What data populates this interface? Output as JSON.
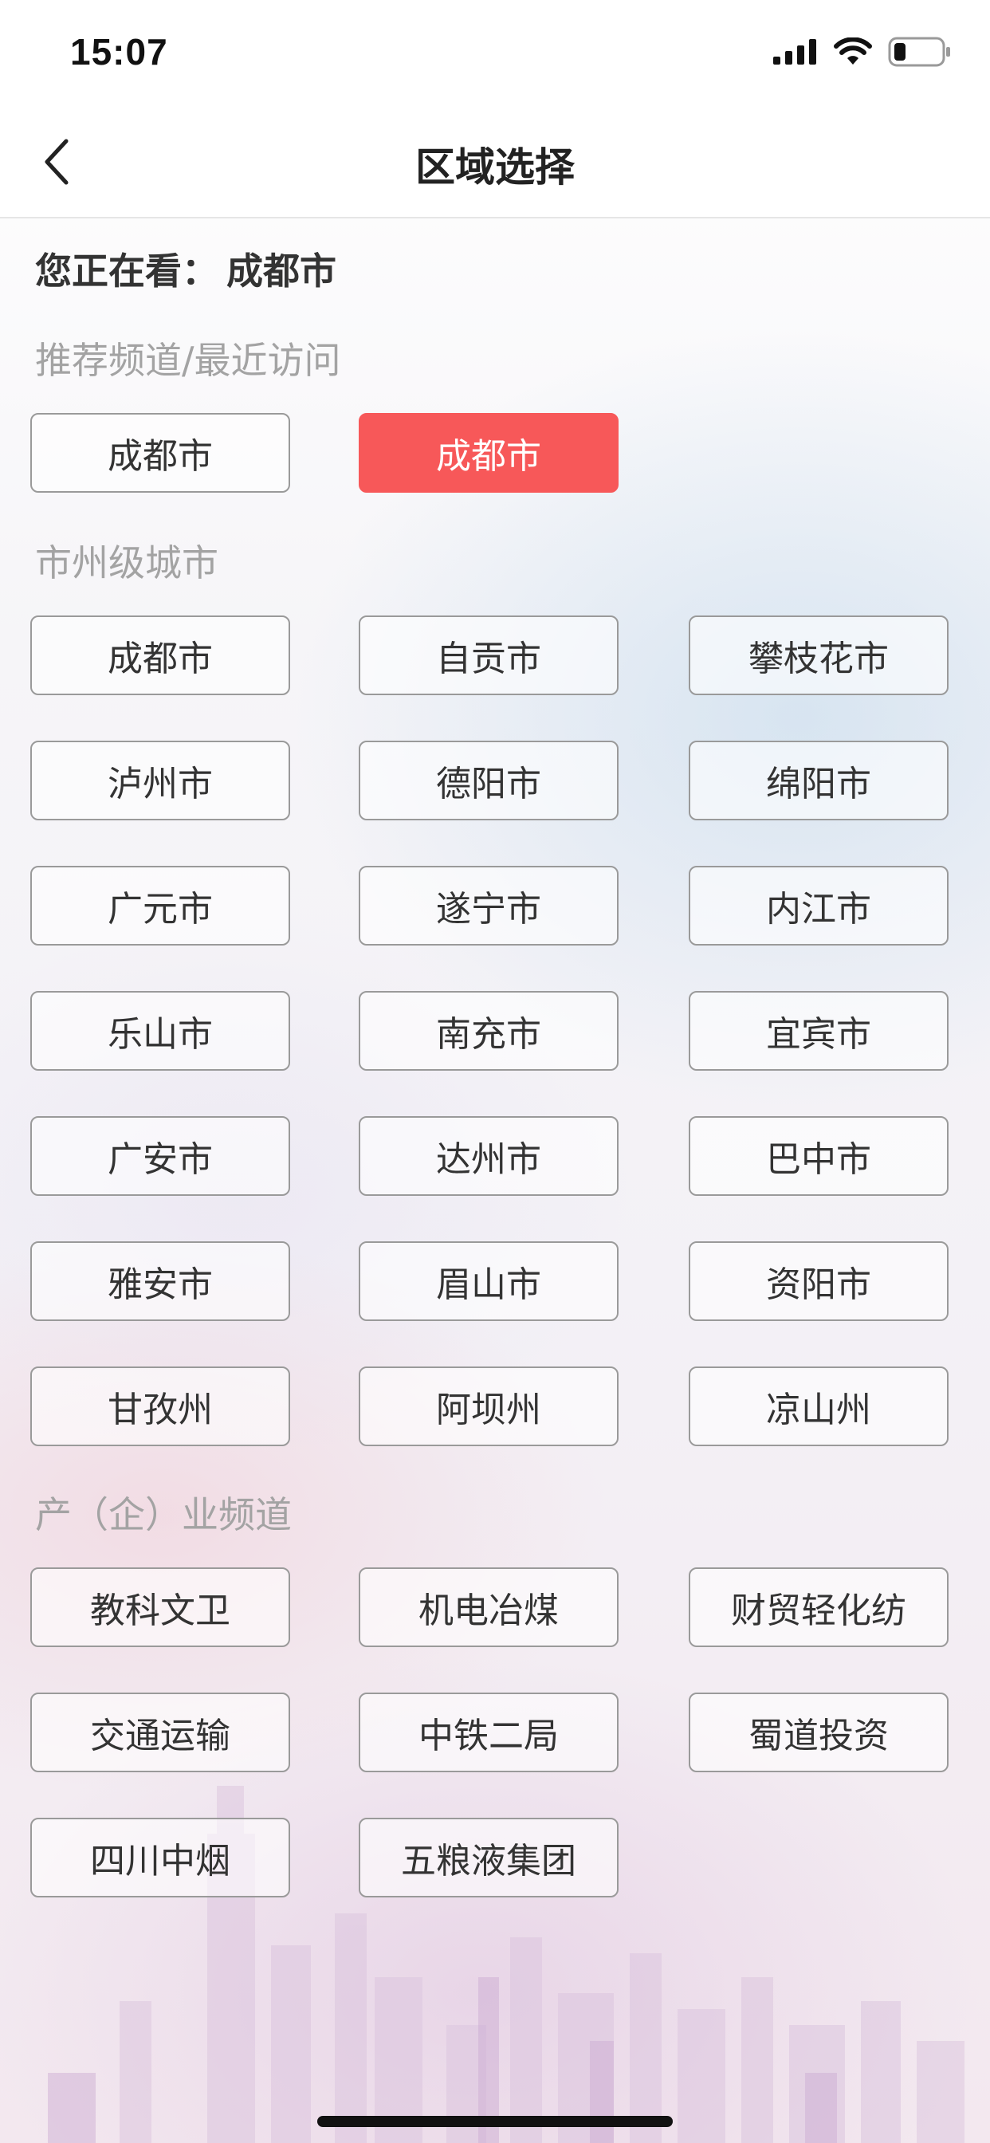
{
  "status_bar": {
    "time": "15:07",
    "icons": [
      "signal-icon",
      "wifi-icon",
      "battery-icon"
    ]
  },
  "nav": {
    "title": "区域选择",
    "back_icon": "chevron-left-icon"
  },
  "current": {
    "label": "您正在看：",
    "city": "成都市"
  },
  "recommend": {
    "title": "推荐频道/最近访问",
    "items": [
      {
        "label": "成都市",
        "active": false
      },
      {
        "label": "成都市",
        "active": true
      }
    ]
  },
  "cities": {
    "title": "市州级城市",
    "items": [
      "成都市",
      "自贡市",
      "攀枝花市",
      "泸州市",
      "德阳市",
      "绵阳市",
      "广元市",
      "遂宁市",
      "内江市",
      "乐山市",
      "南充市",
      "宜宾市",
      "广安市",
      "达州市",
      "巴中市",
      "雅安市",
      "眉山市",
      "资阳市",
      "甘孜州",
      "阿坝州",
      "凉山州"
    ]
  },
  "industry": {
    "title": "产（企）业频道",
    "items": [
      "教科文卫",
      "机电冶煤",
      "财贸轻化纺",
      "交通运输",
      "中铁二局",
      "蜀道投资",
      "四川中烟",
      "五粮液集团"
    ]
  },
  "colors": {
    "accent": "#f75859",
    "border": "#9a9a9a",
    "section_text": "#a3a3a3"
  }
}
